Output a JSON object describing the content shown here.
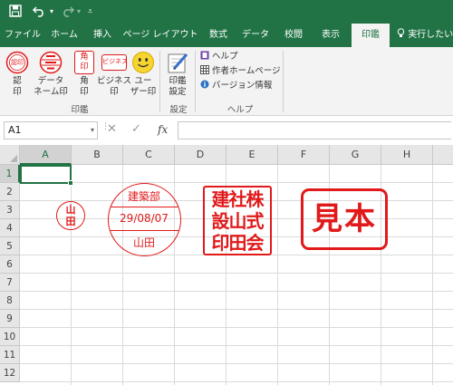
{
  "titlebar": {
    "save_icon": "save-icon",
    "undo_icon": "undo-icon",
    "redo_icon": "redo-icon",
    "customize_icon": "customize-qat-icon"
  },
  "tabs": [
    {
      "label": "ファイル"
    },
    {
      "label": "ホーム"
    },
    {
      "label": "挿入"
    },
    {
      "label": "ページ レイアウト"
    },
    {
      "label": "数式"
    },
    {
      "label": "データ"
    },
    {
      "label": "校閲"
    },
    {
      "label": "表示"
    },
    {
      "label": "印鑑"
    }
  ],
  "tell_me": "実行したい作",
  "ribbon": {
    "stamp_group": {
      "label": "印鑑",
      "buttons": [
        {
          "label": "認\n印",
          "icon": "approval-stamp-icon"
        },
        {
          "label": "データ\nネーム印",
          "icon": "date-name-stamp-icon"
        },
        {
          "label": "角\n印",
          "icon": "square-stamp-icon"
        },
        {
          "label": "ビジネス\n印",
          "icon": "business-stamp-icon"
        },
        {
          "label": "ユー\nザー印",
          "icon": "smiley-icon"
        }
      ],
      "icon_texts": {
        "approval": "認印",
        "square_1": "角",
        "square_2": "印",
        "business": "ビジネス"
      }
    },
    "settings_group": {
      "label": "設定",
      "button": {
        "label": "印鑑\n設定",
        "icon": "stamp-settings-icon"
      }
    },
    "help_group": {
      "label": "ヘルプ",
      "items": [
        {
          "label": "ヘルプ",
          "icon": "help-icon"
        },
        {
          "label": "作者ホームページ",
          "icon": "homepage-icon"
        },
        {
          "label": "バージョン情報",
          "icon": "info-icon"
        }
      ]
    }
  },
  "formula_bar": {
    "name_box": "A1",
    "cancel": "✕",
    "enter": "✓",
    "fx": "fx",
    "value": ""
  },
  "sheet": {
    "columns": [
      "A",
      "B",
      "C",
      "D",
      "E",
      "F",
      "G",
      "H"
    ],
    "rows": [
      "1",
      "2",
      "3",
      "4",
      "5",
      "6",
      "7",
      "8",
      "9",
      "10",
      "11",
      "12"
    ],
    "selected": "A1"
  },
  "stamps": {
    "small_round": {
      "line1": "山",
      "line2": "田"
    },
    "date_stamp": {
      "top": "建築部",
      "middle": "29/08/07",
      "bottom": "山田"
    },
    "square_stamp": {
      "row1": "建社株",
      "row2": "設山式",
      "row3": "印田会"
    },
    "business_stamp": {
      "text": "見本"
    }
  },
  "colors": {
    "excel_green": "#217346",
    "stamp_red": "#e1191a"
  }
}
